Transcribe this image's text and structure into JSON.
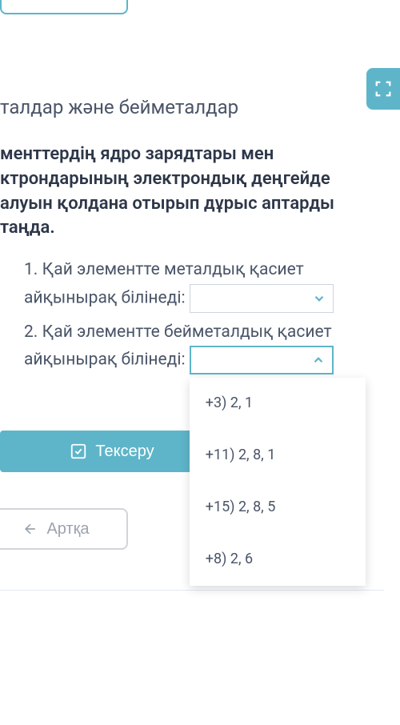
{
  "title": "талдар және бейметалдар",
  "question": "менттердің ядро зарядтары мен ктрондарының электрондық деңгейде алуын қолдана отырып дұрыс аптарды таңда.",
  "items": [
    {
      "number": "1.",
      "text": "Қай элементте металдық қасиет айқынырақ білінеді:"
    },
    {
      "number": "2.",
      "text": "Қай элементте бейметалдық қасиет айқынырақ білінеді:"
    }
  ],
  "dropdown_options": [
    "+3) 2, 1",
    "+11) 2, 8, 1",
    "+15) 2, 8, 5",
    "+8) 2, 6"
  ],
  "buttons": {
    "check": "Тексеру",
    "back": "Артқа"
  }
}
